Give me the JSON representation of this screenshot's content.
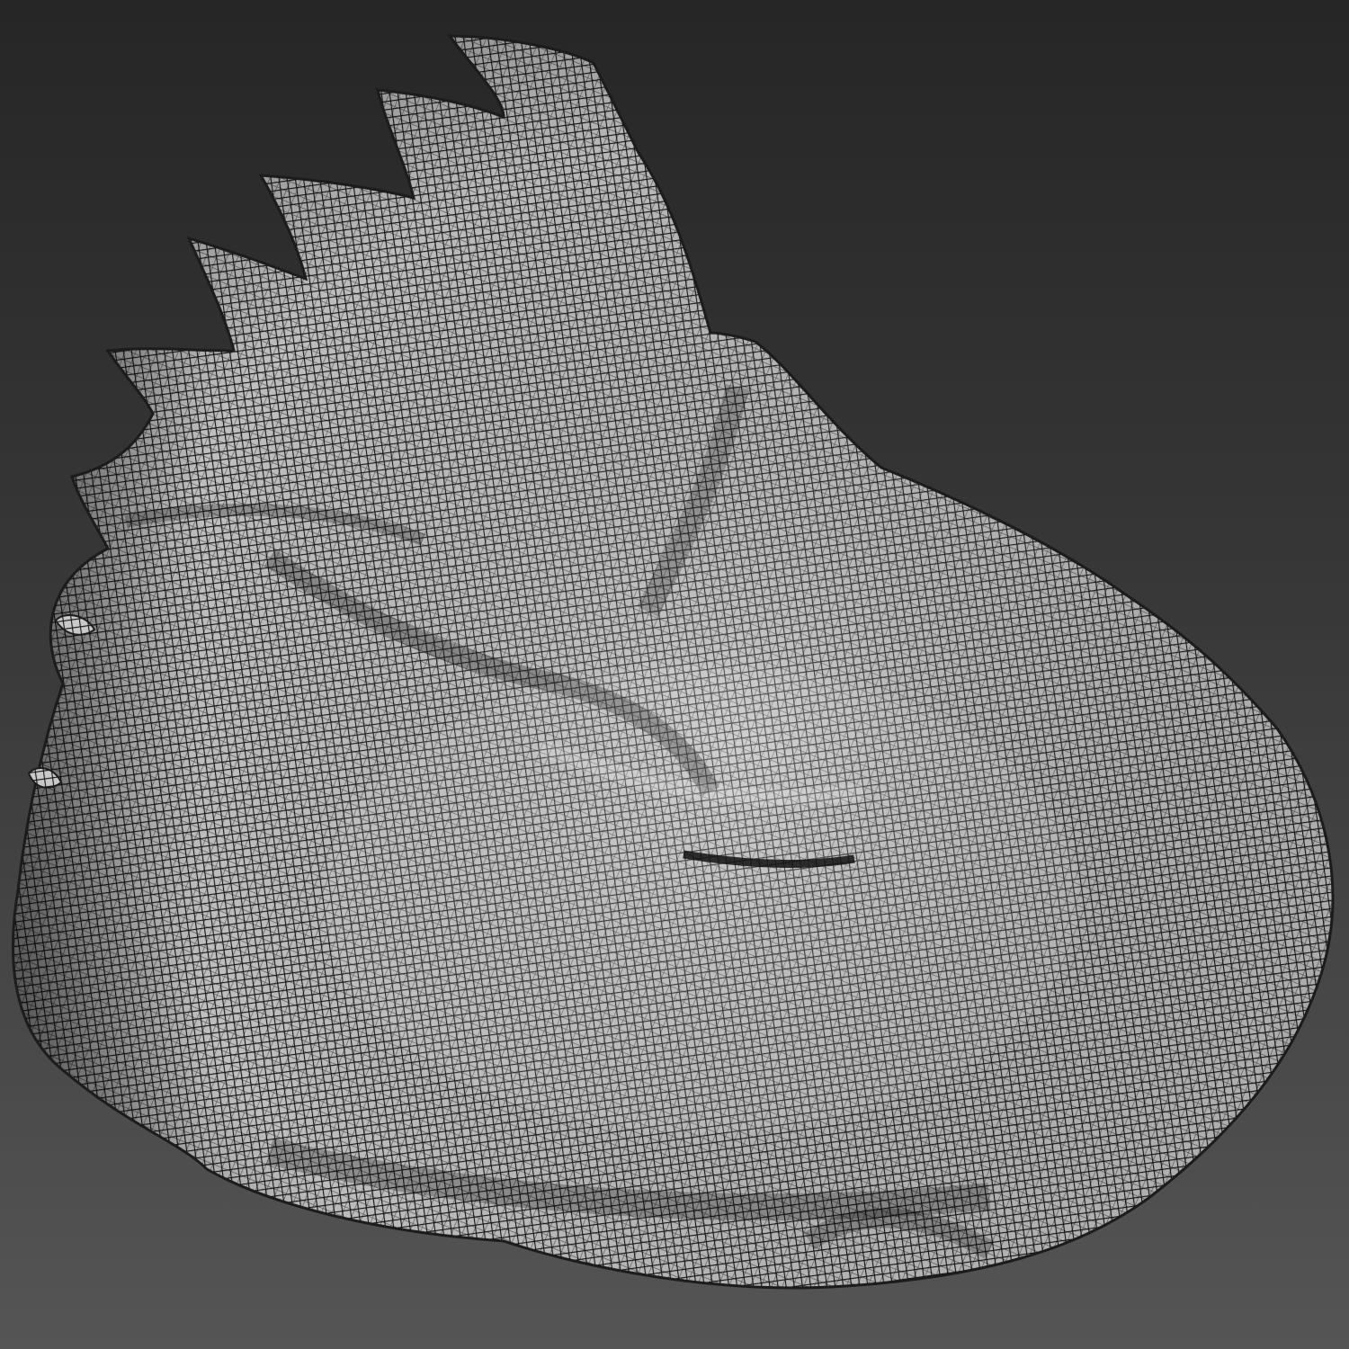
{
  "scene": {
    "subject": "wireframe-mesh-model",
    "colors": {
      "background_top": "#262626",
      "background_bottom": "#555555",
      "mesh_fill": "#8c8c8c",
      "mesh_highlight": "#e6e6e6",
      "mesh_lines": "#111111"
    }
  }
}
